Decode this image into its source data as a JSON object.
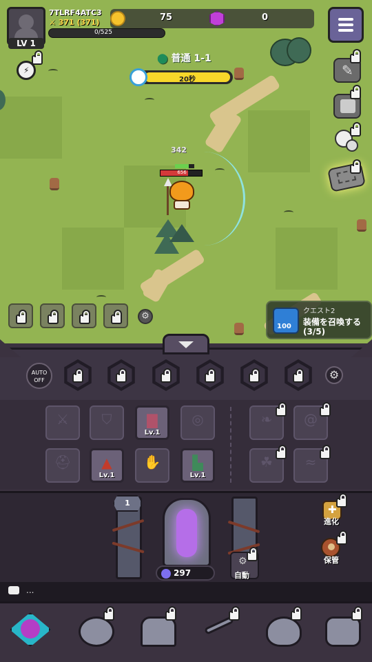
{
  "player": {
    "name": "7TLRF4ATC3",
    "power": "371 (371)",
    "level": "LV 1",
    "xp": "0/525"
  },
  "currency": {
    "gold": "75",
    "gems": "0"
  },
  "stage": {
    "name": "普通 1-1",
    "timer": "20秒",
    "timer_fill": 1.0
  },
  "hero": {
    "hp": "656",
    "damage_popup": "342"
  },
  "quest": {
    "title": "クエスト2",
    "badge": "100",
    "description": "装備を召喚する",
    "progress": "(3/5)"
  },
  "panel": {
    "auto_label": "AUTO OFF",
    "equipment": [
      {
        "name": "weapon",
        "level": "",
        "equipped": false
      },
      {
        "name": "shield",
        "level": "",
        "equipped": false
      },
      {
        "name": "cape",
        "level": "Lv.1",
        "equipped": true
      },
      {
        "name": "ring",
        "level": "",
        "equipped": false
      },
      {
        "name": "helmet",
        "level": "",
        "equipped": false
      },
      {
        "name": "armor",
        "level": "Lv.1",
        "equipped": true
      },
      {
        "name": "gloves",
        "level": "",
        "equipped": false
      },
      {
        "name": "boots",
        "level": "Lv.1",
        "equipped": true
      }
    ],
    "summon_level": "1",
    "summon_cost": "297",
    "auto_summon_label": "自動",
    "evolve_label": "進化",
    "storage_label": "保管"
  },
  "chat": {
    "text": "..."
  },
  "colors": {
    "field": "#93b452",
    "panel": "#3b3240",
    "gold": "#f6c22c",
    "gem": "#c040d8",
    "timer": "#f7d72a",
    "hp": "#d43a3a"
  }
}
